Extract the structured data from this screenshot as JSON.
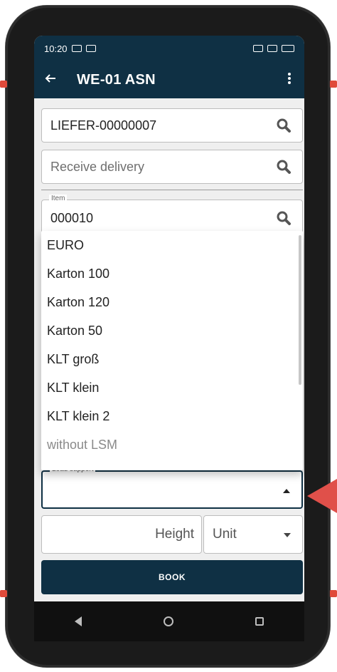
{
  "status_bar": {
    "time": "10:20"
  },
  "toolbar": {
    "title": "WE-01 ASN",
    "back_icon": "arrow-left-icon",
    "more_icon": "more-vert-icon"
  },
  "fields": {
    "supplier_value": "LIEFER-00000007",
    "receive_placeholder": "Receive delivery",
    "item_label": "Item",
    "item_value": "000010",
    "load_support_label": "Load support",
    "height_placeholder": "Height",
    "unit_value": "Unit"
  },
  "dropdown": {
    "options": [
      "EURO",
      "Karton 100",
      "Karton 120",
      "Karton 50",
      "KLT groß",
      "KLT klein",
      "KLT klein 2",
      "without LSM"
    ]
  },
  "actions": {
    "book_label": "BOOK"
  },
  "colors": {
    "primary": "#0f3044",
    "accent_arrow": "#e0504a"
  }
}
